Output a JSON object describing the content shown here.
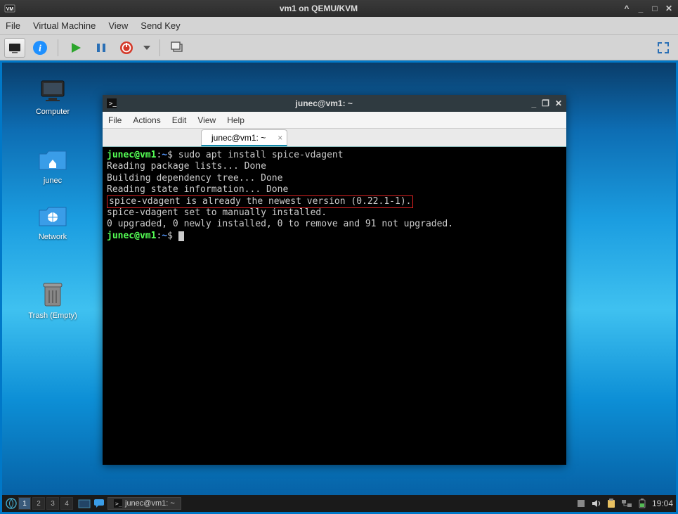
{
  "outer": {
    "title": "vm1 on QEMU/KVM",
    "menu": {
      "file": "File",
      "vm": "Virtual Machine",
      "view": "View",
      "sendkey": "Send Key"
    }
  },
  "desktop_icons": {
    "computer": "Computer",
    "junec": "junec",
    "network": "Network",
    "trash": "Trash (Empty)"
  },
  "terminal": {
    "title": "junec@vm1: ~",
    "menu": {
      "file": "File",
      "actions": "Actions",
      "edit": "Edit",
      "view": "View",
      "help": "Help"
    },
    "tab": "junec@vm1: ~",
    "prompt_user": "junec@vm1",
    "prompt_path": "~",
    "prompt_sep": ":",
    "prompt_dollar": "$",
    "cmd": "sudo apt install spice-vdagent",
    "line1": "Reading package lists... Done",
    "line2": "Building dependency tree... Done",
    "line3": "Reading state information... Done",
    "highlight": "spice-vdagent is already the newest version (0.22.1-1).",
    "line5": "spice-vdagent set to manually installed.",
    "line6": "0 upgraded, 0 newly installed, 0 to remove and 91 not upgraded."
  },
  "taskbar": {
    "workspaces": [
      "1",
      "2",
      "3",
      "4"
    ],
    "task": "junec@vm1: ~",
    "clock": "19:04"
  }
}
